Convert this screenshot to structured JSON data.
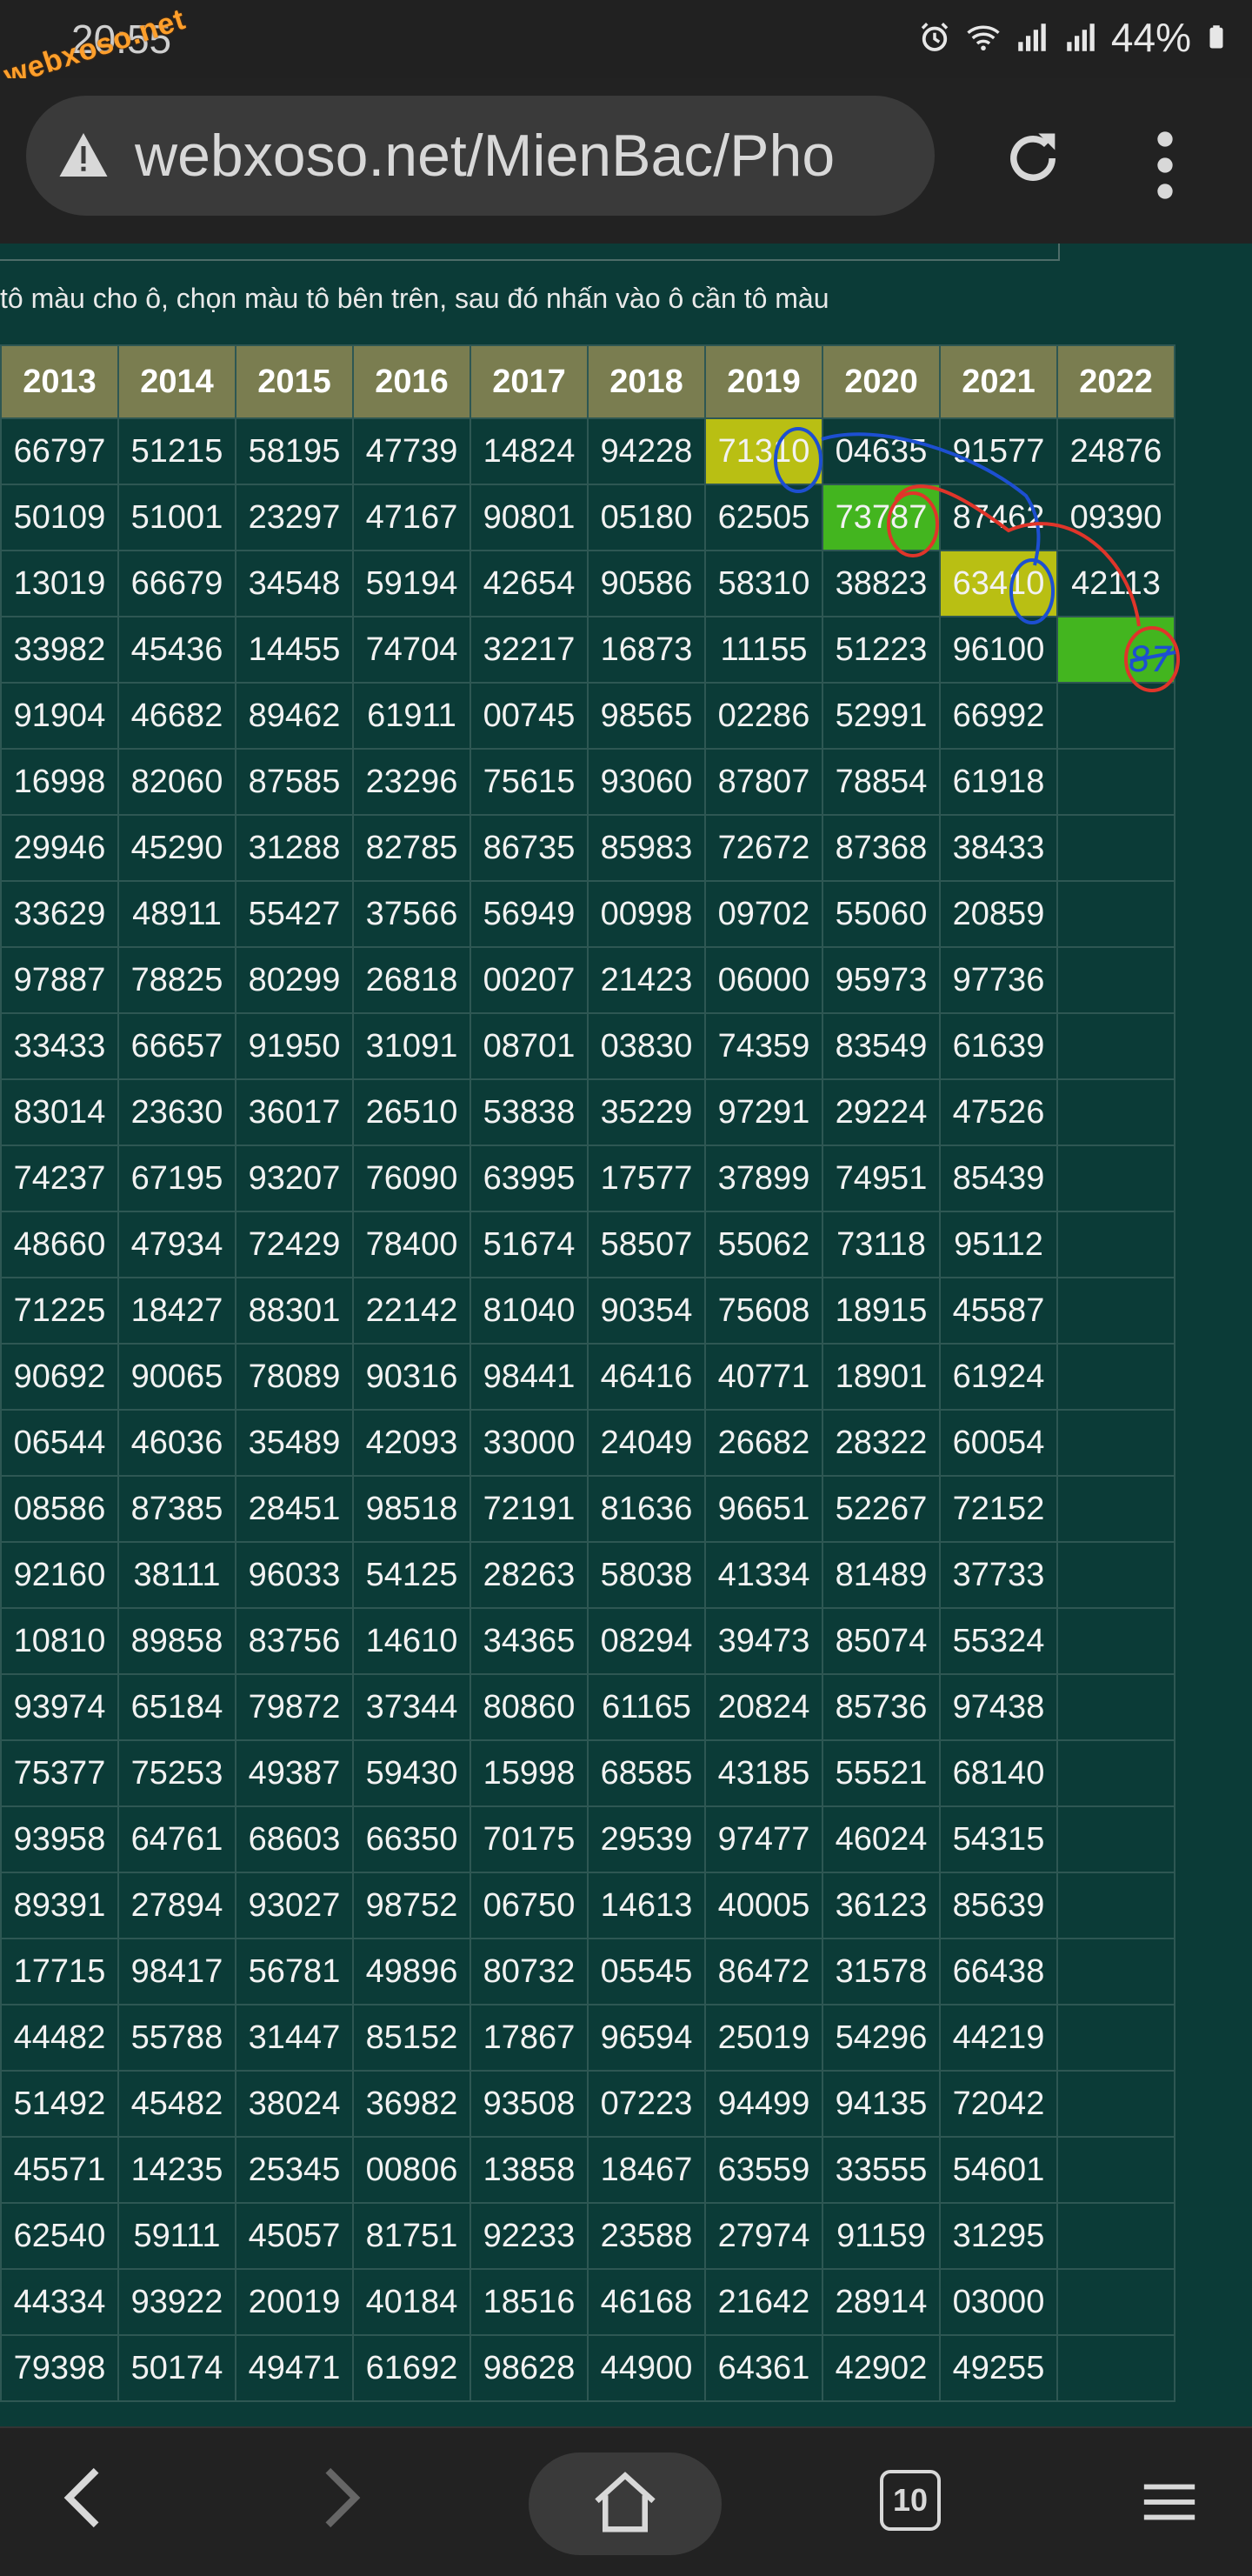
{
  "status_bar": {
    "time": "20:55",
    "battery": "44%",
    "watermark": "webxoso.net",
    "icons": [
      "alarm-icon",
      "wifi-icon",
      "signal-icon",
      "signal-icon",
      "battery-icon"
    ]
  },
  "browser": {
    "url": "webxoso.net/MienBac/Pho",
    "icons": [
      "warning-icon",
      "reload-icon",
      "more-vert-icon"
    ]
  },
  "page": {
    "hint": "tô màu cho ô, chọn màu tô bên trên, sau đó nhấn vào ô cần tô màu",
    "table": {
      "headers": [
        "2013",
        "2014",
        "2015",
        "2016",
        "2017",
        "2018",
        "2019",
        "2020",
        "2021",
        "2022"
      ],
      "rows": [
        [
          "66797",
          "51215",
          "58195",
          "47739",
          "14824",
          "94228",
          "71310",
          "04635",
          "91577",
          "24876"
        ],
        [
          "50109",
          "51001",
          "23297",
          "47167",
          "90801",
          "05180",
          "62505",
          "73787",
          "87462",
          "09390"
        ],
        [
          "13019",
          "66679",
          "34548",
          "59194",
          "42654",
          "90586",
          "58310",
          "38823",
          "63410",
          "42113"
        ],
        [
          "33982",
          "45436",
          "14455",
          "74704",
          "32217",
          "16873",
          "11155",
          "51223",
          "96100",
          ""
        ],
        [
          "91904",
          "46682",
          "89462",
          "61911",
          "00745",
          "98565",
          "02286",
          "52991",
          "66992",
          ""
        ],
        [
          "16998",
          "82060",
          "87585",
          "23296",
          "75615",
          "93060",
          "87807",
          "78854",
          "61918",
          ""
        ],
        [
          "29946",
          "45290",
          "31288",
          "82785",
          "86735",
          "85983",
          "72672",
          "87368",
          "38433",
          ""
        ],
        [
          "33629",
          "48911",
          "55427",
          "37566",
          "56949",
          "00998",
          "09702",
          "55060",
          "20859",
          ""
        ],
        [
          "97887",
          "78825",
          "80299",
          "26818",
          "00207",
          "21423",
          "06000",
          "95973",
          "97736",
          ""
        ],
        [
          "33433",
          "66657",
          "91950",
          "31091",
          "08701",
          "03830",
          "74359",
          "83549",
          "61639",
          ""
        ],
        [
          "83014",
          "23630",
          "36017",
          "26510",
          "53838",
          "35229",
          "97291",
          "29224",
          "47526",
          ""
        ],
        [
          "74237",
          "67195",
          "93207",
          "76090",
          "63995",
          "17577",
          "37899",
          "74951",
          "85439",
          ""
        ],
        [
          "48660",
          "47934",
          "72429",
          "78400",
          "51674",
          "58507",
          "55062",
          "73118",
          "95112",
          ""
        ],
        [
          "71225",
          "18427",
          "88301",
          "22142",
          "81040",
          "90354",
          "75608",
          "18915",
          "45587",
          ""
        ],
        [
          "90692",
          "90065",
          "78089",
          "90316",
          "98441",
          "46416",
          "40771",
          "18901",
          "61924",
          ""
        ],
        [
          "06544",
          "46036",
          "35489",
          "42093",
          "33000",
          "24049",
          "26682",
          "28322",
          "60054",
          ""
        ],
        [
          "08586",
          "87385",
          "28451",
          "98518",
          "72191",
          "81636",
          "96651",
          "52267",
          "72152",
          ""
        ],
        [
          "92160",
          "38111",
          "96033",
          "54125",
          "28263",
          "58038",
          "41334",
          "81489",
          "37733",
          ""
        ],
        [
          "10810",
          "89858",
          "83756",
          "14610",
          "34365",
          "08294",
          "39473",
          "85074",
          "55324",
          ""
        ],
        [
          "93974",
          "65184",
          "79872",
          "37344",
          "80860",
          "61165",
          "20824",
          "85736",
          "97438",
          ""
        ],
        [
          "75377",
          "75253",
          "49387",
          "59430",
          "15998",
          "68585",
          "43185",
          "55521",
          "68140",
          ""
        ],
        [
          "93958",
          "64761",
          "68603",
          "66350",
          "70175",
          "29539",
          "97477",
          "46024",
          "54315",
          ""
        ],
        [
          "89391",
          "27894",
          "93027",
          "98752",
          "06750",
          "14613",
          "40005",
          "36123",
          "85639",
          ""
        ],
        [
          "17715",
          "98417",
          "56781",
          "49896",
          "80732",
          "05545",
          "86472",
          "31578",
          "66438",
          ""
        ],
        [
          "44482",
          "55788",
          "31447",
          "85152",
          "17867",
          "96594",
          "25019",
          "54296",
          "44219",
          ""
        ],
        [
          "51492",
          "45482",
          "38024",
          "36982",
          "93508",
          "07223",
          "94499",
          "94135",
          "72042",
          ""
        ],
        [
          "45571",
          "14235",
          "25345",
          "00806",
          "13858",
          "18467",
          "63559",
          "33555",
          "54601",
          ""
        ],
        [
          "62540",
          "59111",
          "45057",
          "81751",
          "92233",
          "23588",
          "27974",
          "91159",
          "31295",
          ""
        ],
        [
          "44334",
          "93922",
          "20019",
          "40184",
          "18516",
          "46168",
          "21642",
          "28914",
          "03000",
          ""
        ],
        [
          "79398",
          "50174",
          "49471",
          "61692",
          "98628",
          "44900",
          "64361",
          "42902",
          "49255",
          ""
        ]
      ],
      "highlights": [
        {
          "row": 0,
          "col": 6,
          "color": "#b9bf13"
        },
        {
          "row": 1,
          "col": 7,
          "color": "#43b51f"
        },
        {
          "row": 2,
          "col": 8,
          "color": "#b9bf13"
        },
        {
          "row": 3,
          "col": 9,
          "color": "#43b51f"
        }
      ],
      "handwritten_note": "87"
    }
  },
  "bottom_nav": {
    "tabs_count": "10",
    "icons": [
      "back-icon",
      "forward-icon",
      "home-icon",
      "tabs-icon",
      "menu-icon"
    ]
  }
}
